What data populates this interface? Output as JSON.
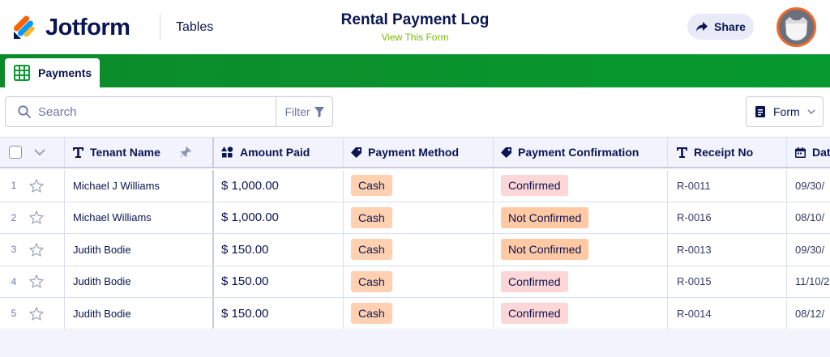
{
  "header": {
    "brand": "Jotform",
    "product": "Tables",
    "title": "Rental Payment Log",
    "view_form_link": "View This Form",
    "share_label": "Share"
  },
  "tabs": [
    {
      "label": "Payments"
    }
  ],
  "toolbar": {
    "search_placeholder": "Search",
    "filter_label": "Filter",
    "form_label": "Form"
  },
  "columns": [
    {
      "label": "Tenant Name",
      "icon": "text-icon"
    },
    {
      "label": "Amount Paid",
      "icon": "shapes-icon"
    },
    {
      "label": "Payment Method",
      "icon": "tag-icon"
    },
    {
      "label": "Payment Confirmation",
      "icon": "tag-icon"
    },
    {
      "label": "Receipt No",
      "icon": "text-icon"
    },
    {
      "label": "Dat",
      "icon": "calendar-icon"
    }
  ],
  "rows": [
    {
      "num": "1",
      "tenant": "Michael J Williams",
      "amount": "$ 1,000.00",
      "method": "Cash",
      "confirmation": "Confirmed",
      "receipt": "R-0011",
      "date": "09/30/"
    },
    {
      "num": "2",
      "tenant": "Michael Williams",
      "amount": "$ 1,000.00",
      "method": "Cash",
      "confirmation": "Not Confirmed",
      "receipt": "R-0016",
      "date": "08/10/"
    },
    {
      "num": "3",
      "tenant": "Judith Bodie",
      "amount": "$ 150.00",
      "method": "Cash",
      "confirmation": "Not Confirmed",
      "receipt": "R-0013",
      "date": "09/30/"
    },
    {
      "num": "4",
      "tenant": "Judith Bodie",
      "amount": "$ 150.00",
      "method": "Cash",
      "confirmation": "Confirmed",
      "receipt": "R-0015",
      "date": "11/10/2"
    },
    {
      "num": "5",
      "tenant": "Judith Bodie",
      "amount": "$ 150.00",
      "method": "Cash",
      "confirmation": "Confirmed",
      "receipt": "R-0014",
      "date": "08/12/"
    }
  ],
  "colors": {
    "brand_navy": "#0a1551",
    "tab_strip_green": "#0c8a2a",
    "view_form_green": "#78bb07",
    "confirmed_tag": "#fdd7d7",
    "not_confirmed_tag": "#ffc9a3",
    "method_tag": "#ffd1b0",
    "avatar_ring": "#f06b2a"
  }
}
